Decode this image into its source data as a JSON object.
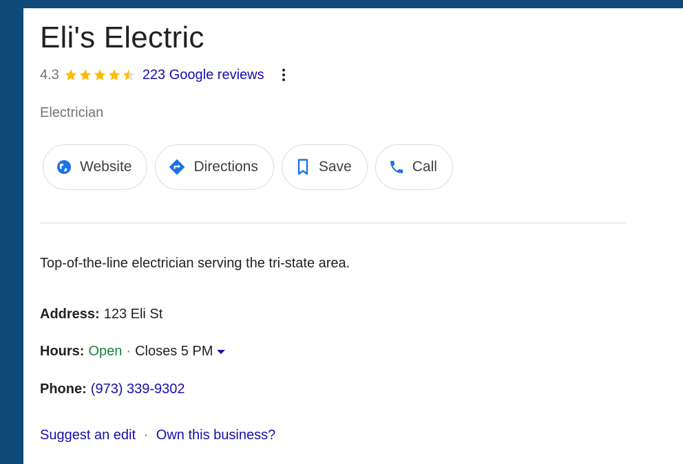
{
  "business": {
    "name": "Eli's Electric",
    "rating": "4.3",
    "stars_filled_fraction": 0.86,
    "reviews_label": "223 Google reviews",
    "category": "Electrician"
  },
  "actions": [
    {
      "label": "Website",
      "icon": "globe-icon"
    },
    {
      "label": "Directions",
      "icon": "directions-icon"
    },
    {
      "label": "Save",
      "icon": "bookmark-icon"
    },
    {
      "label": "Call",
      "icon": "phone-icon"
    }
  ],
  "description": "Top-of-the-line electrician serving the tri-state area.",
  "details": {
    "address_label": "Address:",
    "address_value": "123 Eli St",
    "hours_label": "Hours:",
    "hours_status": "Open",
    "hours_separator": "·",
    "hours_closes": "Closes 5 PM",
    "phone_label": "Phone:",
    "phone_value": "(973) 339-9302"
  },
  "footer": {
    "suggest_edit": "Suggest an edit",
    "separator": "·",
    "own_business": "Own this business?"
  },
  "colors": {
    "background": "#0f4a7a",
    "star": "#fbbc04",
    "link": "#1a0dab",
    "open": "#188038",
    "icon_blue": "#1a73e8"
  }
}
